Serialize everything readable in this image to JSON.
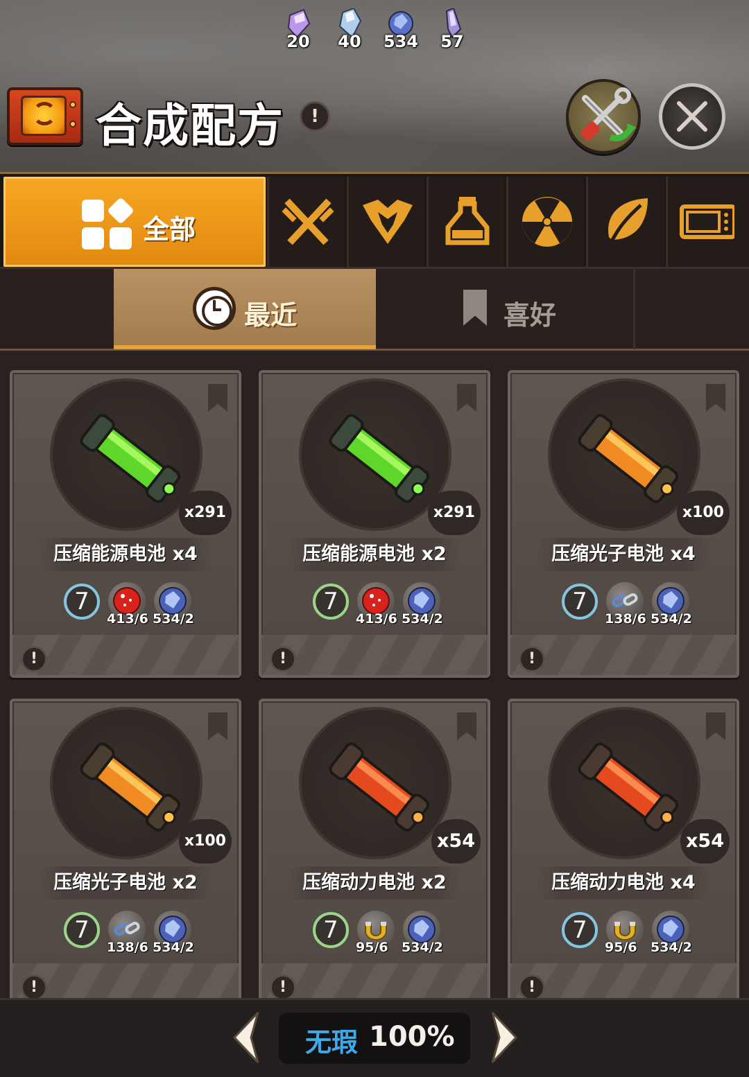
{
  "currencies": [
    {
      "icon": "purple-crystal-icon",
      "value": "20",
      "color": "#c9a0ee"
    },
    {
      "icon": "ice-crystal-icon",
      "value": "40",
      "color": "#b9d4f2"
    },
    {
      "icon": "blue-orb-icon",
      "value": "534",
      "color": "#6f86d6"
    },
    {
      "icon": "violet-shard-icon",
      "value": "57",
      "color": "#a79be0"
    }
  ],
  "header": {
    "title": "合成配方",
    "info": "!"
  },
  "categories": {
    "active_label": "全部",
    "tabs": [
      "weapons-icon",
      "armor-icon",
      "potion-icon",
      "radiation-icon",
      "leaf-icon",
      "device-icon"
    ],
    "accent": "#f0a030"
  },
  "subtabs": {
    "recent": "最近",
    "favorites": "喜好"
  },
  "recipes": [
    {
      "name": "压缩能源电池 x4",
      "count": "x291",
      "liquid": "green",
      "level": "7",
      "level_color": "blue",
      "materials": [
        {
          "icon": "red-orb-icon",
          "count": "413/6"
        },
        {
          "icon": "blue-orb-icon",
          "count": "534/2"
        }
      ]
    },
    {
      "name": "压缩能源电池 x2",
      "count": "x291",
      "liquid": "green",
      "level": "7",
      "level_color": "green",
      "materials": [
        {
          "icon": "red-orb-icon",
          "count": "413/6"
        },
        {
          "icon": "blue-orb-icon",
          "count": "534/2"
        }
      ]
    },
    {
      "name": "压缩光子电池 x4",
      "count": "x100",
      "liquid": "orange",
      "level": "7",
      "level_color": "blue",
      "materials": [
        {
          "icon": "chain-link-icon",
          "count": "138/6"
        },
        {
          "icon": "blue-orb-icon",
          "count": "534/2"
        }
      ]
    },
    {
      "name": "压缩光子电池 x2",
      "count": "x100",
      "liquid": "orange",
      "level": "7",
      "level_color": "green",
      "materials": [
        {
          "icon": "chain-link-icon",
          "count": "138/6"
        },
        {
          "icon": "blue-orb-icon",
          "count": "534/2"
        }
      ]
    },
    {
      "name": "压缩动力电池 x2",
      "count": "x54",
      "liquid": "red",
      "level": "7",
      "level_color": "green",
      "materials": [
        {
          "icon": "magnet-icon",
          "count": "95/6"
        },
        {
          "icon": "blue-orb-icon",
          "count": "534/2"
        }
      ]
    },
    {
      "name": "压缩动力电池 x4",
      "count": "x54",
      "liquid": "red",
      "level": "7",
      "level_color": "blue",
      "materials": [
        {
          "icon": "magnet-icon",
          "count": "95/6"
        },
        {
          "icon": "blue-orb-icon",
          "count": "534/2"
        }
      ]
    }
  ],
  "footer": {
    "quality_label": "无瑕",
    "quality_value": "100%"
  }
}
